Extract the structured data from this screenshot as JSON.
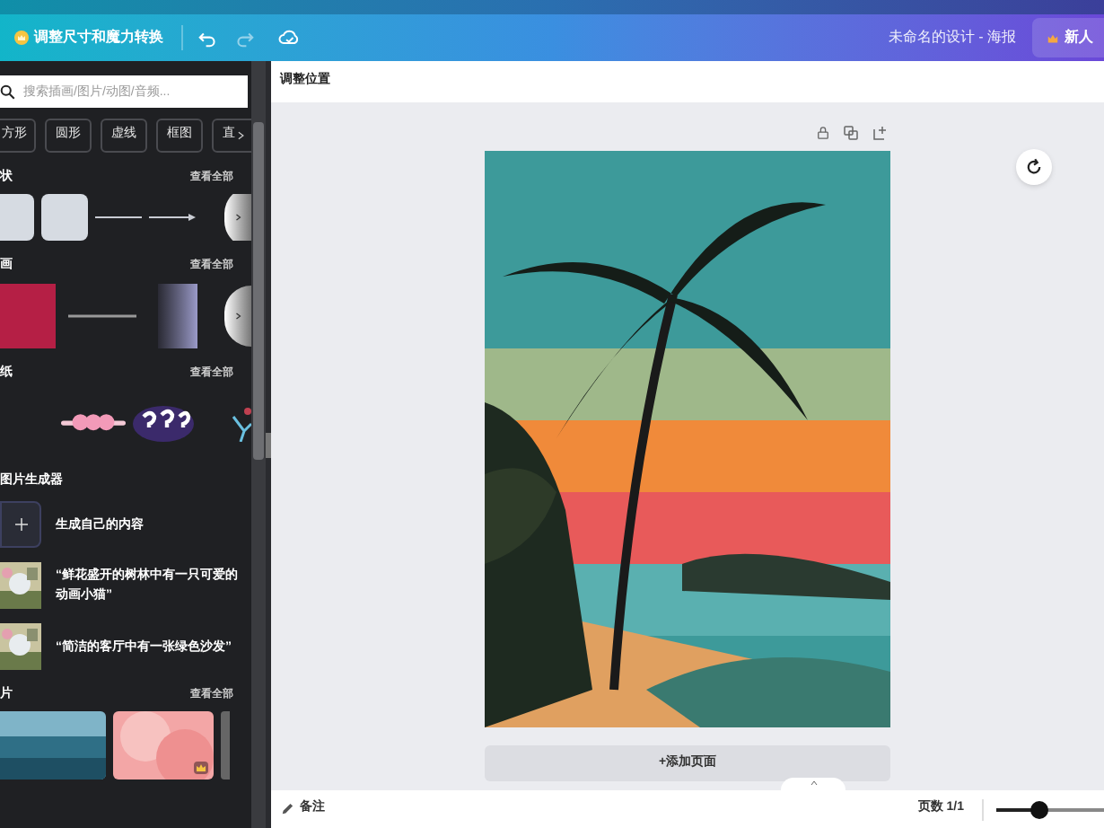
{
  "toolbar": {
    "resize_button": "调整尺寸和魔力转换",
    "design_title": "未命名的设计 - 海报",
    "new_button": "新人"
  },
  "sidebar": {
    "search": {
      "placeholder": "搜索插画/图片/动图/音频..."
    },
    "chips": [
      "方形",
      "圆形",
      "虚线",
      "框图",
      "直"
    ],
    "sections": [
      {
        "kind": "shapes",
        "title": "状",
        "see_all": "查看全部"
      },
      {
        "kind": "graphics",
        "title": "画",
        "see_all": "查看全部"
      },
      {
        "kind": "stickers",
        "title": "纸",
        "see_all": "查看全部"
      },
      {
        "kind": "generator",
        "title": "图片生成器",
        "items": [
          {
            "kind": "create",
            "text": "生成自己的内容"
          },
          {
            "kind": "prompt",
            "text": "“鲜花盛开的树林中有一只可爱的动画小猫”"
          },
          {
            "kind": "prompt",
            "text": "“简洁的客厅中有一张绿色沙发”"
          }
        ]
      },
      {
        "kind": "photos",
        "title": "片",
        "see_all": "查看全部"
      }
    ]
  },
  "header": {
    "title": "调整位置"
  },
  "canvas": {
    "add_page": "+添加页面"
  },
  "status_bar": {
    "notes": "备注",
    "pages": "页数 1/1",
    "zoom": {
      "level": 0.4
    }
  }
}
